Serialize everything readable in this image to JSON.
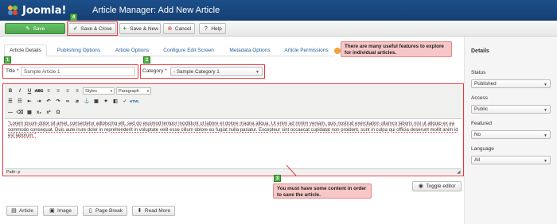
{
  "header": {
    "logo_text": "Joomla!",
    "title": "Article Manager: Add New Article"
  },
  "toolbar": {
    "save_label": "Save",
    "save_close_label": "Save & Close",
    "save_new_label": "Save & New",
    "cancel_label": "Cancel",
    "help_label": "Help"
  },
  "tabs": [
    "Article Details",
    "Publishing Options",
    "Article Options",
    "Configure Edit Screen",
    "Metadata Options",
    "Article Permissions"
  ],
  "callouts": {
    "features": "There are many useful features to explore for individual articles.",
    "content": "You must have some content in order to save the article."
  },
  "markers": [
    "1",
    "2",
    "3",
    "4"
  ],
  "form": {
    "title_label": "Title",
    "title_value": "Sample Article 1",
    "category_label": "Category",
    "category_value": "- Sample Category 1",
    "required": "*"
  },
  "editor": {
    "styles_label": "Styles",
    "format_label": "Paragraph",
    "body_text": "\"Lorem ipsum dolor sit amet, consectetur adipiscing elit, sed do eiusmod tempor incididunt ut labore et dolore magna aliqua. Ut enim ad minim veniam, quis nostrud exercitation ullamco laboris nisi ut aliquip ex ea commodo consequat. Duis aute irure dolor in reprehenderit in voluptate velit esse cillum dolore eu fugiat nulla pariatur. Excepteur sint occaecat cupidatat non proident, sunt in culpa qui officia deserunt mollit anim id est laborum.\"",
    "path_label": "Path: p"
  },
  "bottom_buttons": {
    "article": "Article",
    "image": "Image",
    "page_break": "Page Break",
    "read_more": "Read More",
    "toggle_editor": "Toggle editor"
  },
  "sidebar": {
    "title": "Details",
    "status_label": "Status",
    "status_value": "Published",
    "access_label": "Access",
    "access_value": "Public",
    "featured_label": "Featured",
    "featured_value": "No",
    "language_label": "Language",
    "language_value": "All"
  },
  "colors": {
    "header_bg": "#1d4f8a",
    "save_green": "#51a351",
    "callout_bg": "#f7c6c6",
    "highlight_red": "#e8383d",
    "marker_green": "#55b24a"
  }
}
